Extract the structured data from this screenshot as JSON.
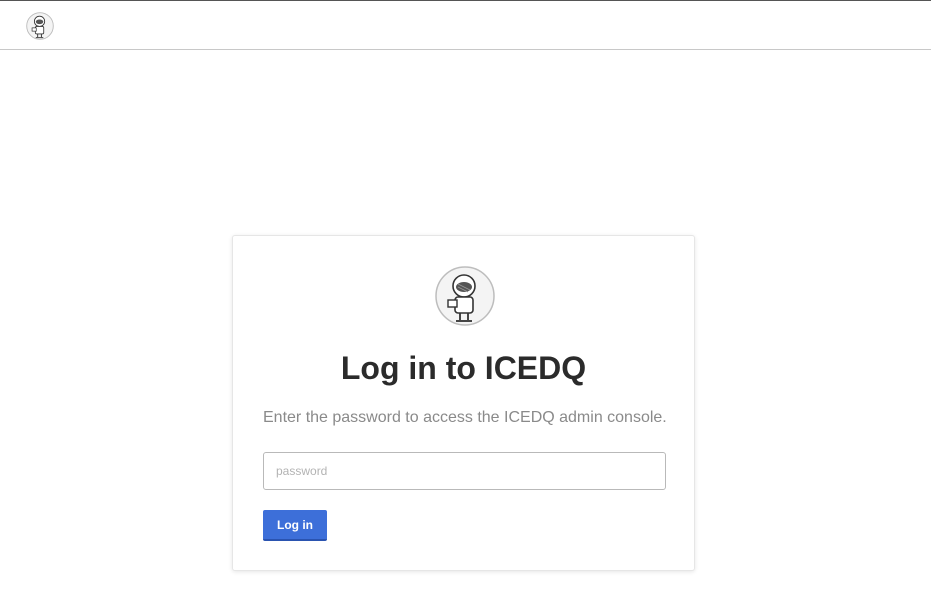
{
  "header": {
    "logo_icon": "astronaut-logo-icon"
  },
  "login": {
    "avatar_icon": "astronaut-avatar-icon",
    "title": "Log in to ICEDQ",
    "subtitle": "Enter the password to access the ICEDQ admin console.",
    "password_placeholder": "password",
    "password_value": "",
    "login_label": "Log in"
  },
  "colors": {
    "accent": "#3d6fd9",
    "title": "#2b2b2b",
    "subtitle": "#8a8a8a"
  }
}
